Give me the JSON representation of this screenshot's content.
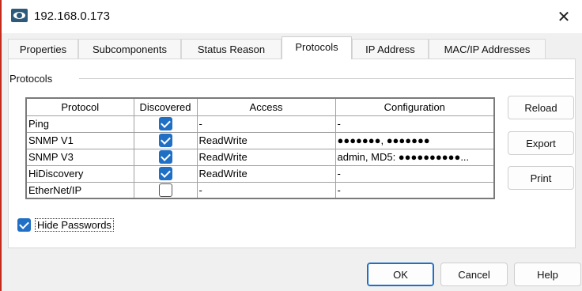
{
  "window": {
    "title": "192.168.0.173",
    "close_glyph": "✕",
    "icon": "eye-icon"
  },
  "tabs": [
    {
      "label": "Properties",
      "active": false
    },
    {
      "label": "Subcomponents",
      "active": false
    },
    {
      "label": "Status Reason",
      "active": false
    },
    {
      "label": "Protocols",
      "active": true
    },
    {
      "label": "IP Address",
      "active": false
    },
    {
      "label": "MAC/IP Addresses",
      "active": false
    }
  ],
  "protocols": {
    "group_label": "Protocols",
    "columns": [
      "Protocol",
      "Discovered",
      "Access",
      "Configuration"
    ],
    "rows": [
      {
        "protocol": "Ping",
        "discovered": true,
        "access": "-",
        "configuration": "-"
      },
      {
        "protocol": "SNMP V1",
        "discovered": true,
        "access": "ReadWrite",
        "configuration": "●●●●●●●, ●●●●●●●"
      },
      {
        "protocol": "SNMP V3",
        "discovered": true,
        "access": "ReadWrite",
        "configuration": "admin, MD5: ●●●●●●●●●●..."
      },
      {
        "protocol": "HiDiscovery",
        "discovered": true,
        "access": "ReadWrite",
        "configuration": "-"
      },
      {
        "protocol": "EtherNet/IP",
        "discovered": false,
        "access": "-",
        "configuration": "-"
      }
    ]
  },
  "side_buttons": {
    "reload": "Reload",
    "export": "Export",
    "print": "Print"
  },
  "hide_passwords": {
    "label": "Hide Passwords",
    "checked": true
  },
  "footer": {
    "ok": "OK",
    "cancel": "Cancel",
    "help": "Help"
  },
  "colors": {
    "accent": "#1f6fc5",
    "window_border": "#c42b1c"
  }
}
